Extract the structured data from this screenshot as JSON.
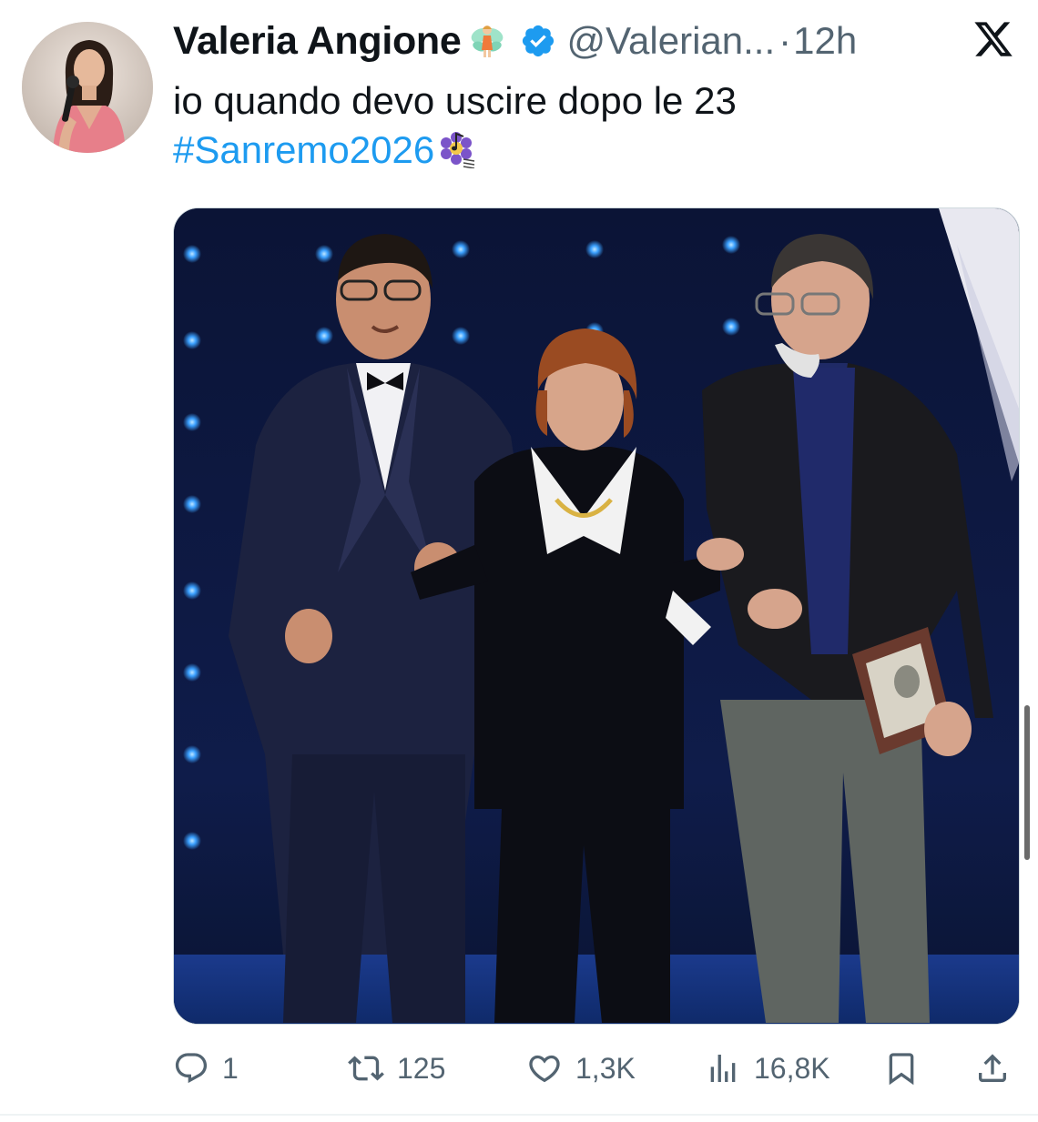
{
  "tweet": {
    "display_name": "Valeria Angione",
    "name_emoji": "fairy-emoji",
    "verified_icon": "verified-badge-icon",
    "handle": "@Valerian...",
    "separator": "·",
    "time": "12h",
    "text_line1": "io quando devo uscire dopo le 23",
    "hashtag": "#Sanremo2026",
    "hashtag_emoji": "sanremo-flower-music-emoji",
    "platform_icon": "x-logo-icon"
  },
  "media": {
    "kind": "photo",
    "subject": "three-people-walking-arm-in-arm-on-stage"
  },
  "actions": {
    "replies": "1",
    "reposts": "125",
    "likes": "1,3K",
    "views": "16,8K",
    "bookmark_icon": "bookmark-icon",
    "share_icon": "share-icon"
  },
  "colors": {
    "text": "#0f1419",
    "secondary": "#536471",
    "link": "#1d9bf0",
    "verified": "#1d9bf0"
  }
}
